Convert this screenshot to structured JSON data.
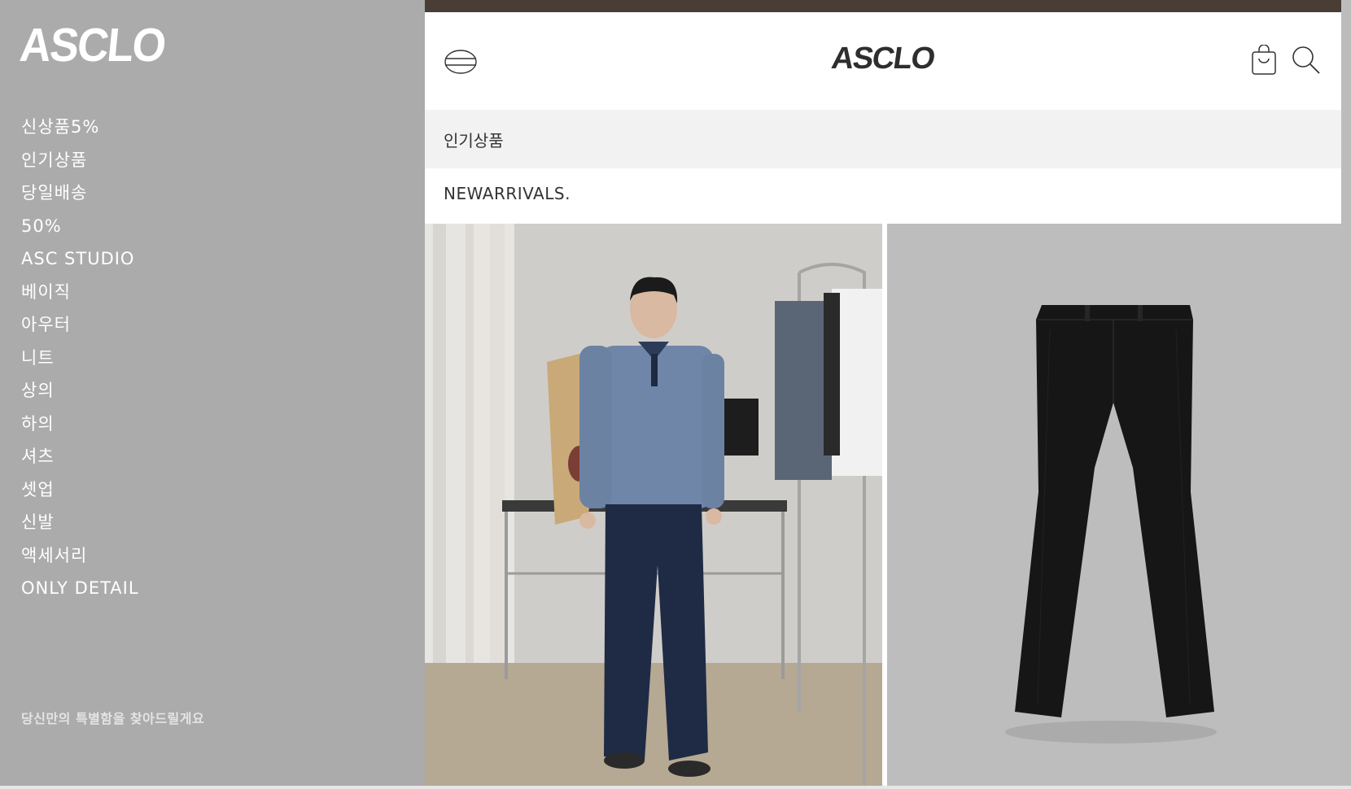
{
  "sidebar": {
    "logo": "ASCLO",
    "items": [
      {
        "label": "신상품5%"
      },
      {
        "label": "인기상품"
      },
      {
        "label": "당일배송"
      },
      {
        "label": "50%"
      },
      {
        "label": "ASC STUDIO"
      },
      {
        "label": "베이직"
      },
      {
        "label": "아우터"
      },
      {
        "label": "니트"
      },
      {
        "label": "상의"
      },
      {
        "label": "하의"
      },
      {
        "label": "셔츠"
      },
      {
        "label": "셋업"
      },
      {
        "label": "신발"
      },
      {
        "label": "액세서리"
      },
      {
        "label": "ONLY DETAIL"
      }
    ],
    "tagline": "당신만의 특별함을 찾아드릴게요"
  },
  "header": {
    "brand": "ASCLO",
    "icons": [
      "menu-icon",
      "cart-icon",
      "search-icon"
    ]
  },
  "tab_bar": {
    "label": "인기상품"
  },
  "section": {
    "title": "NEWARRIVALS."
  },
  "products": [
    {
      "name": "model-blue-jacket-photo"
    },
    {
      "name": "black-flare-trousers-photo"
    }
  ],
  "colors": {
    "sidebar_bg": "#ababab",
    "top_strip": "#4a3d36",
    "tab_bar_bg": "#f2f2f2",
    "text_dark": "#333333"
  }
}
